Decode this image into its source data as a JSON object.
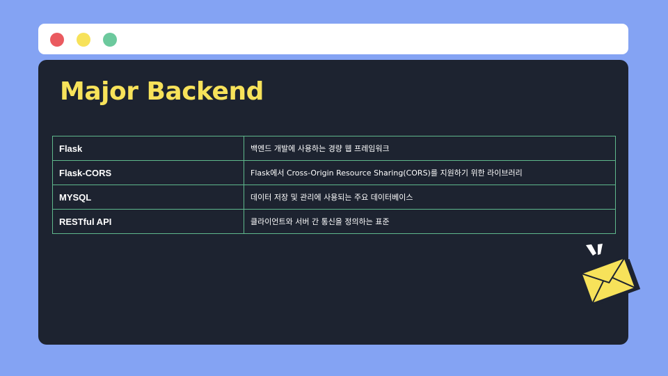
{
  "window": {
    "controls": [
      {
        "name": "close",
        "color": "#ea5a5f"
      },
      {
        "name": "minimize",
        "color": "#f7e25a"
      },
      {
        "name": "maximize",
        "color": "#6cc99d"
      }
    ]
  },
  "slide": {
    "title": "Major Backend",
    "table": {
      "rows": [
        {
          "name": "Flask",
          "description": "백엔드 개발에 사용하는 경량 웹 프레임워크"
        },
        {
          "name": "Flask-CORS",
          "description": "Flask에서 Cross-Origin Resource Sharing(CORS)를 지원하기 위한 라이브러리"
        },
        {
          "name": "MYSQL",
          "description": "데이터 저장 및 관리에 사용되는 주요 데이터베이스"
        },
        {
          "name": "RESTful API",
          "description": "클라이언트와 서버 간 통신을 정의하는 표준"
        }
      ]
    },
    "decoration": {
      "icon": "envelope-icon",
      "fill": "#f7e25a",
      "shadow": "#1d2330"
    }
  },
  "colors": {
    "background": "#84a3f3",
    "panel": "#1d2330",
    "accent": "#f7e25a",
    "table_border": "#5fb98d",
    "text": "#ffffff"
  }
}
